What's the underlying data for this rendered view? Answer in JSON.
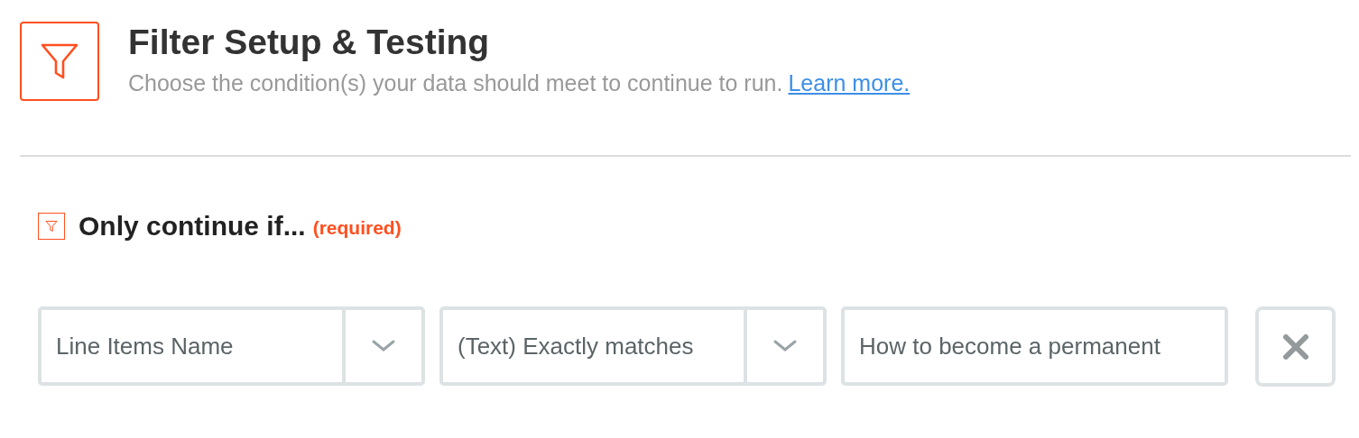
{
  "header": {
    "title": "Filter Setup & Testing",
    "description": "Choose the condition(s) your data should meet to continue to run.",
    "link": "Learn more."
  },
  "section": {
    "title": "Only continue if...",
    "required": "(required)"
  },
  "conditions": [
    {
      "kind": "select",
      "value": "Line Items Name"
    },
    {
      "kind": "select",
      "value": "(Text) Exactly matches"
    },
    {
      "kind": "text",
      "value": "How to become a permanent"
    }
  ]
}
